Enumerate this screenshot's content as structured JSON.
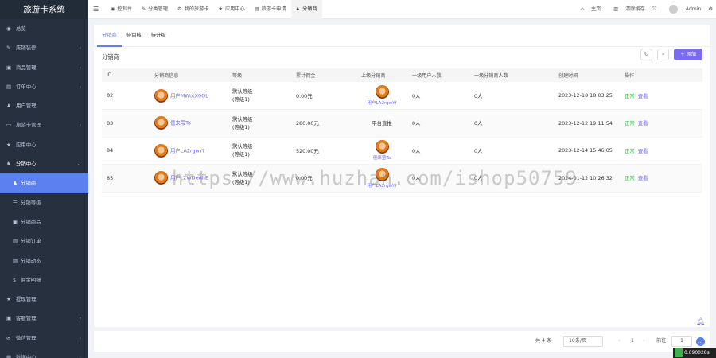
{
  "app": {
    "title": "旅游卡系统"
  },
  "sidebar": {
    "items": [
      {
        "label": "总览",
        "icon": "gauge-icon",
        "expandable": false
      },
      {
        "label": "店铺装修",
        "icon": "brush-icon",
        "expandable": true
      },
      {
        "label": "商品管理",
        "icon": "box-icon",
        "expandable": true
      },
      {
        "label": "订单中心",
        "icon": "file-icon",
        "expandable": true
      },
      {
        "label": "用户管理",
        "icon": "user-icon",
        "expandable": false
      },
      {
        "label": "旅游卡管理",
        "icon": "card-icon",
        "expandable": true
      },
      {
        "label": "应用中心",
        "icon": "star-icon",
        "expandable": false
      },
      {
        "label": "分销中心",
        "icon": "users-icon",
        "expandable": true,
        "open": true
      }
    ],
    "subitems": [
      {
        "label": "分销商",
        "icon": "user-icon",
        "active": true
      },
      {
        "label": "分销等级",
        "icon": "list-icon"
      },
      {
        "label": "分销商品",
        "icon": "box-icon"
      },
      {
        "label": "分销订单",
        "icon": "file-icon"
      },
      {
        "label": "分销动态",
        "icon": "image-icon"
      },
      {
        "label": "佣金明细",
        "icon": "dollar-icon"
      }
    ],
    "items_after": [
      {
        "label": "提现管理",
        "icon": "star-icon",
        "expandable": false
      },
      {
        "label": "客服管理",
        "icon": "box-icon",
        "expandable": true
      },
      {
        "label": "微信管理",
        "icon": "chat-icon",
        "expandable": true
      },
      {
        "label": "数据中心",
        "icon": "chart-icon",
        "expandable": true
      }
    ]
  },
  "topbar": {
    "tabs": [
      {
        "label": "控制台",
        "icon": "gauge-icon"
      },
      {
        "label": "分类管理",
        "icon": "brush-icon"
      },
      {
        "label": "我的旅游卡",
        "icon": "gear-icon"
      },
      {
        "label": "应用中心",
        "icon": "star-icon"
      },
      {
        "label": "旅游卡申请",
        "icon": "file-icon"
      },
      {
        "label": "分销商",
        "icon": "user-icon",
        "active": true
      }
    ],
    "home_label": "主页",
    "clear_cache_label": "清除缓存",
    "username": "Admin"
  },
  "main": {
    "subtabs": [
      {
        "label": "分销商",
        "active": true
      },
      {
        "label": "待审核"
      },
      {
        "label": "待升级"
      }
    ],
    "section_title": "分销商",
    "add_label": "+ 添加",
    "table": {
      "columns": [
        "ID",
        "分销商信息",
        "等级",
        "累计佣金",
        "上级分销商",
        "一级用户人数",
        "一级分销商人数",
        "创建时间",
        "操作"
      ],
      "rows": [
        {
          "id": "82",
          "name": "用户MWotX0OL",
          "level": "默认等级",
          "level_sub": "(等级1)",
          "commission": "0.00元",
          "parent": "用户LA2rgwYf",
          "parent_has_avatar": true,
          "users": "0人",
          "distributors": "0人",
          "created": "2023-12-18 18:03:25",
          "status": "正常",
          "action": "查看"
        },
        {
          "id": "83",
          "name": "僮来萤Ta",
          "level": "默认等级",
          "level_sub": "(等级1)",
          "commission": "280.00元",
          "parent": "平台直推",
          "parent_has_avatar": false,
          "users": "0人",
          "distributors": "0人",
          "created": "2023-12-12 19:11:54",
          "status": "正常",
          "action": "查看"
        },
        {
          "id": "84",
          "name": "用户LA2rgwYf",
          "level": "默认等级",
          "level_sub": "(等级1)",
          "commission": "520.00元",
          "parent": "僮来萤Ta",
          "parent_has_avatar": true,
          "users": "0人",
          "distributors": "0人",
          "created": "2023-12-14 15:46:05",
          "status": "正常",
          "action": "查看"
        },
        {
          "id": "85",
          "name": "用户c2WDeAhE",
          "level": "默认等级",
          "level_sub": "(等级1)",
          "commission": "0.00元",
          "parent": "用户LA2rgwYf",
          "parent_has_avatar": true,
          "users": "0人",
          "distributors": "0人",
          "created": "2024-01-12 10:26:32",
          "status": "正常",
          "action": "查看"
        }
      ]
    }
  },
  "pagination": {
    "total_label": "共 4 条",
    "page_size": "10条/页",
    "current_page": "1",
    "goto_label": "前往",
    "goto_value": "1"
  },
  "watermark": "https://www.huzhan.com/ishop50759",
  "status_tag": "0.090028s",
  "colors": {
    "accent": "#5d80f0",
    "add_button": "#7b6bf2",
    "sidebar_bg": "#27303f",
    "status_ok": "#3bb24b"
  }
}
